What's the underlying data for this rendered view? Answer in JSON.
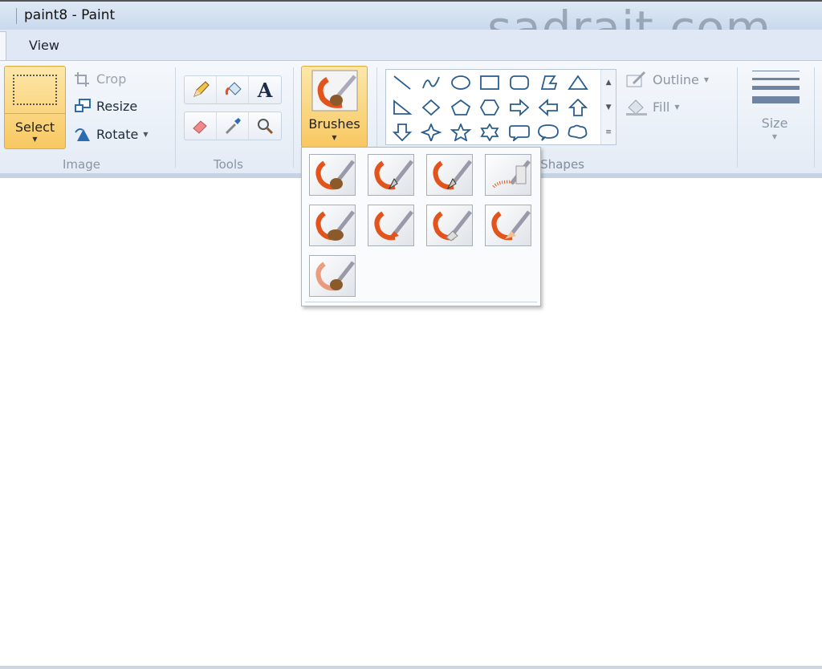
{
  "window": {
    "title": "paint8 - Paint",
    "watermark": "sadrait.com"
  },
  "tabs": [
    {
      "label": "View"
    }
  ],
  "ribbon": {
    "image_group": {
      "label": "Image",
      "select": "Select",
      "crop": "Crop",
      "resize": "Resize",
      "rotate": "Rotate"
    },
    "tools_group": {
      "label": "Tools",
      "tools": [
        "pencil-icon",
        "fill-bucket-icon",
        "text-icon",
        "eraser-icon",
        "color-picker-icon",
        "magnifier-icon"
      ]
    },
    "brushes": {
      "label": "Brushes"
    },
    "shapes_group": {
      "label": "Shapes",
      "visible_label": "hapes",
      "outline": "Outline",
      "fill": "Fill",
      "shapes": [
        "line",
        "curve",
        "oval",
        "rectangle",
        "rounded-rectangle",
        "polygon",
        "triangle",
        "right-triangle",
        "diamond",
        "pentagon",
        "hexagon",
        "right-arrow",
        "left-arrow",
        "up-arrow",
        "down-arrow",
        "four-point-star",
        "five-point-star",
        "six-point-star",
        "rounded-callout",
        "oval-callout",
        "cloud-callout"
      ]
    },
    "size": {
      "label": "Size"
    }
  },
  "brushes_menu": {
    "items": [
      "brush",
      "calligraphy-brush-1",
      "calligraphy-brush-2",
      "airbrush",
      "oil-brush",
      "crayon",
      "marker",
      "natural-pencil",
      "watercolor-brush"
    ]
  },
  "colors": {
    "accent": "#f8c861",
    "brush_stroke": "#e2541b",
    "shape_stroke": "#2b5d8c"
  }
}
